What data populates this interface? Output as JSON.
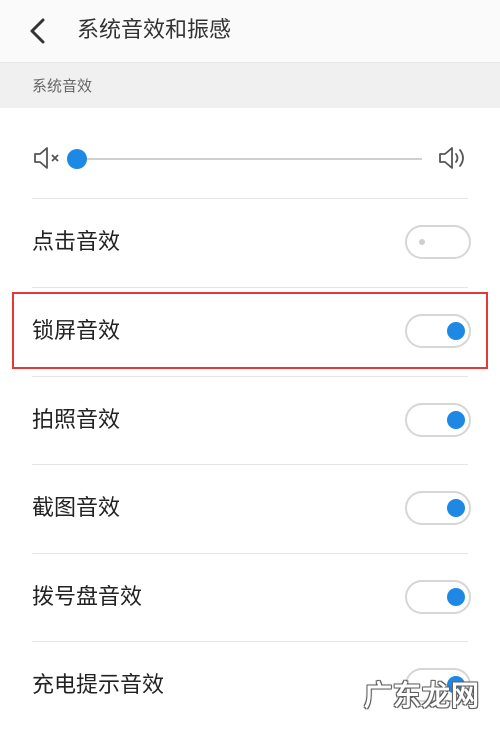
{
  "header": {
    "title": "系统音效和振感"
  },
  "section": {
    "label": "系统音效"
  },
  "volume": {
    "level": 0.02,
    "mute_icon": "volume-mute-icon",
    "loud_icon": "volume-up-icon"
  },
  "rows": [
    {
      "label": "点击音效",
      "on": false
    },
    {
      "label": "锁屏音效",
      "on": true,
      "highlighted": true
    },
    {
      "label": "拍照音效",
      "on": true
    },
    {
      "label": "截图音效",
      "on": true
    },
    {
      "label": "拨号盘音效",
      "on": true
    },
    {
      "label": "充电提示音效",
      "on": true
    }
  ],
  "colors": {
    "accent": "#1e88e5",
    "highlight": "#e53935"
  },
  "watermark": {
    "text": "广东龙网"
  }
}
